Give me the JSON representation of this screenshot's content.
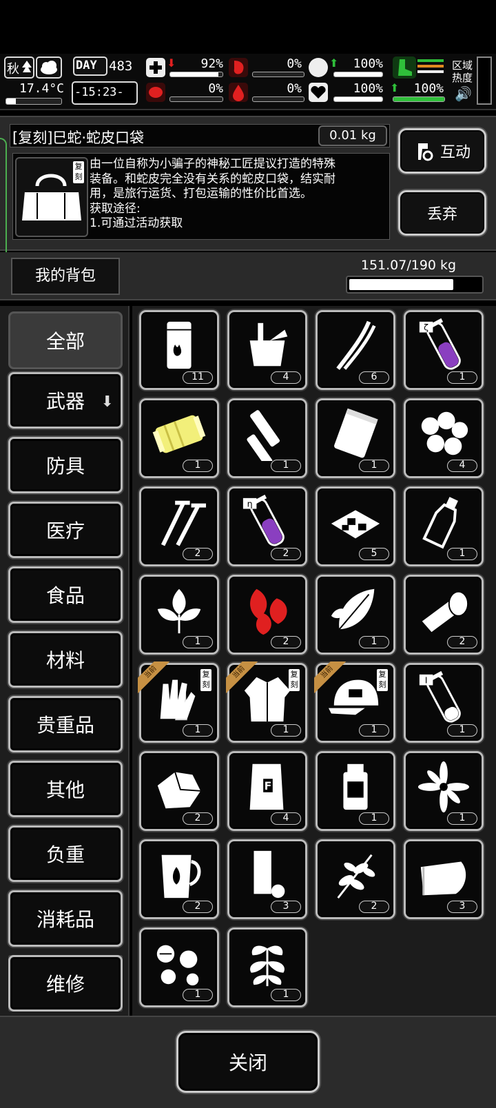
{
  "status": {
    "season": "秋",
    "temperature": "17.4°C",
    "day_label": "DAY",
    "day": "483",
    "time": "-15:23-",
    "health_pct": "92%",
    "hunger_pct": "0%",
    "shield_pct": "100%",
    "brain_pct": "0%",
    "thirst_pct": "0%",
    "heart_pct": "100%",
    "stamina_pct": "100%",
    "area_heat_label": "区域热度"
  },
  "item": {
    "title": "[复刻]巳蛇·蛇皮口袋",
    "weight": "0.01 kg",
    "badge": "复刻",
    "desc": [
      "由一位自称为小骗子的神秘工匠提议打造的特殊",
      "装备。和蛇皮完全没有关系的蛇皮口袋，结实耐",
      "用，是旅行运货、打包运输的性价比首选。",
      "获取途径:",
      "1.可通过活动获取"
    ],
    "interact_label": "互动",
    "discard_label": "丢弃"
  },
  "backpack": {
    "label": "我的背包",
    "capacity": "151.07/190 kg",
    "fill": 0.795
  },
  "categories": [
    "全部",
    "武器",
    "防具",
    "医疗",
    "食品",
    "材料",
    "贵重品",
    "其他",
    "负重",
    "消耗品",
    "维修"
  ],
  "items": [
    {
      "icon": "fuel-barrel-icon",
      "count": "11"
    },
    {
      "icon": "bucket-icon",
      "count": "4"
    },
    {
      "icon": "herb-stalks-icon",
      "count": "6"
    },
    {
      "icon": "purple-vial-icon",
      "count": "1",
      "vial_label": "ζ"
    },
    {
      "icon": "yellow-spool-icon",
      "count": "1"
    },
    {
      "icon": "batteries-icon",
      "count": "1"
    },
    {
      "icon": "pouch-icon",
      "count": "1"
    },
    {
      "icon": "cotton-balls-icon",
      "count": "4"
    },
    {
      "icon": "screws-icon",
      "count": "2"
    },
    {
      "icon": "purple-vial-icon",
      "count": "2",
      "vial_label": "η"
    },
    {
      "icon": "crackers-icon",
      "count": "5"
    },
    {
      "icon": "bottle-icon",
      "count": "1"
    },
    {
      "icon": "mint-leaves-icon",
      "count": "1"
    },
    {
      "icon": "red-leaves-icon",
      "count": "2"
    },
    {
      "icon": "leaf-icon",
      "count": "1"
    },
    {
      "icon": "bandage-roll-icon",
      "count": "2"
    },
    {
      "icon": "gloves-icon",
      "count": "1",
      "badge": "复刻",
      "ribbon": "当前"
    },
    {
      "icon": "jacket-icon",
      "count": "1",
      "badge": "复刻",
      "ribbon": "当前"
    },
    {
      "icon": "cap-icon",
      "count": "1",
      "badge": "复刻",
      "ribbon": "当前"
    },
    {
      "icon": "empty-vial-icon",
      "count": "1",
      "vial_label": "I"
    },
    {
      "icon": "rock-icon",
      "count": "2"
    },
    {
      "icon": "flour-bag-icon",
      "count": "4",
      "bag_label": "F"
    },
    {
      "icon": "jar-icon",
      "count": "1"
    },
    {
      "icon": "flower-icon",
      "count": "1"
    },
    {
      "icon": "tea-pitcher-icon",
      "count": "2"
    },
    {
      "icon": "tube-icon",
      "count": "3"
    },
    {
      "icon": "herb-branch-icon",
      "count": "2"
    },
    {
      "icon": "cloth-icon",
      "count": "3"
    },
    {
      "icon": "pills-icon",
      "count": "1"
    },
    {
      "icon": "plant-icon",
      "count": "1"
    }
  ],
  "close_label": "关闭",
  "colors": {
    "accent_green": "#4caf50",
    "alert_red": "#e02020",
    "ribbon_gold": "#c69043",
    "vial_purple": "#8a3fc0"
  }
}
